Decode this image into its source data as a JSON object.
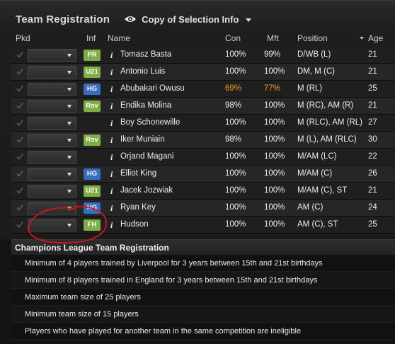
{
  "panel": {
    "title": "Team Registration",
    "view_selector": "Copy of Selection Info",
    "view_icon": "eye-icon"
  },
  "columns": {
    "pkd": "Pkd",
    "inf": "Inf",
    "name": "Name",
    "con": "Con",
    "mft": "Mft",
    "position": "Position",
    "age": "Age"
  },
  "colors": {
    "badge_green": "#7fae48",
    "badge_blue": "#3a6cc0",
    "highlight_orange": "#f0a020"
  },
  "players": [
    {
      "inf": "PR",
      "inf_color": "green",
      "name": "Tomasz Basta",
      "con": "100%",
      "mft": "99%",
      "position": "D/WB (L)",
      "age": "21"
    },
    {
      "inf": "U21",
      "inf_color": "green",
      "name": "Antonio Luis",
      "con": "100%",
      "mft": "100%",
      "position": "DM, M (C)",
      "age": "21"
    },
    {
      "inf": "HG",
      "inf_color": "blue",
      "name": "Abubakari Owusu",
      "con": "69%",
      "mft": "77%",
      "position": "M (RL)",
      "age": "25",
      "low": true
    },
    {
      "inf": "Rsv",
      "inf_color": "green",
      "name": "Endika Molina",
      "con": "98%",
      "mft": "100%",
      "position": "M (RC), AM (R)",
      "age": "21"
    },
    {
      "inf": "",
      "inf_color": "none",
      "name": "Boy Schonewille",
      "con": "100%",
      "mft": "100%",
      "position": "M (RLC), AM (RL)",
      "age": "27"
    },
    {
      "inf": "Rsv",
      "inf_color": "green",
      "name": "Iker Muniain",
      "con": "98%",
      "mft": "100%",
      "position": "M (L), AM (RLC)",
      "age": "30"
    },
    {
      "inf": "",
      "inf_color": "none",
      "name": "Orjand Magani",
      "con": "100%",
      "mft": "100%",
      "position": "M/AM (LC)",
      "age": "22"
    },
    {
      "inf": "HG",
      "inf_color": "blue",
      "name": "Elliot King",
      "con": "100%",
      "mft": "100%",
      "position": "M/AM (C)",
      "age": "26"
    },
    {
      "inf": "U21",
      "inf_color": "green",
      "name": "Jacek Jozwiak",
      "con": "100%",
      "mft": "100%",
      "position": "M/AM (C), ST",
      "age": "21"
    },
    {
      "inf": "HG",
      "inf_color": "blue",
      "name": "Ryan Key",
      "con": "100%",
      "mft": "100%",
      "position": "AM (C)",
      "age": "24"
    },
    {
      "inf": "FH",
      "inf_color": "green",
      "name": "Hudson",
      "con": "100%",
      "mft": "100%",
      "position": "AM (C), ST",
      "age": "25"
    }
  ],
  "competition": {
    "title": "Champions League Team Registration",
    "rules": [
      "Minimum of 4 players trained by Liverpool for 3 years between 15th and 21st birthdays",
      "Minimum of 8 players trained in England for 3 years between 15th and 21st birthdays",
      "Maximum team size of 25 players",
      "Minimum team size of 15 players",
      "Players who have played for another team in the same competition are ineligible"
    ]
  }
}
